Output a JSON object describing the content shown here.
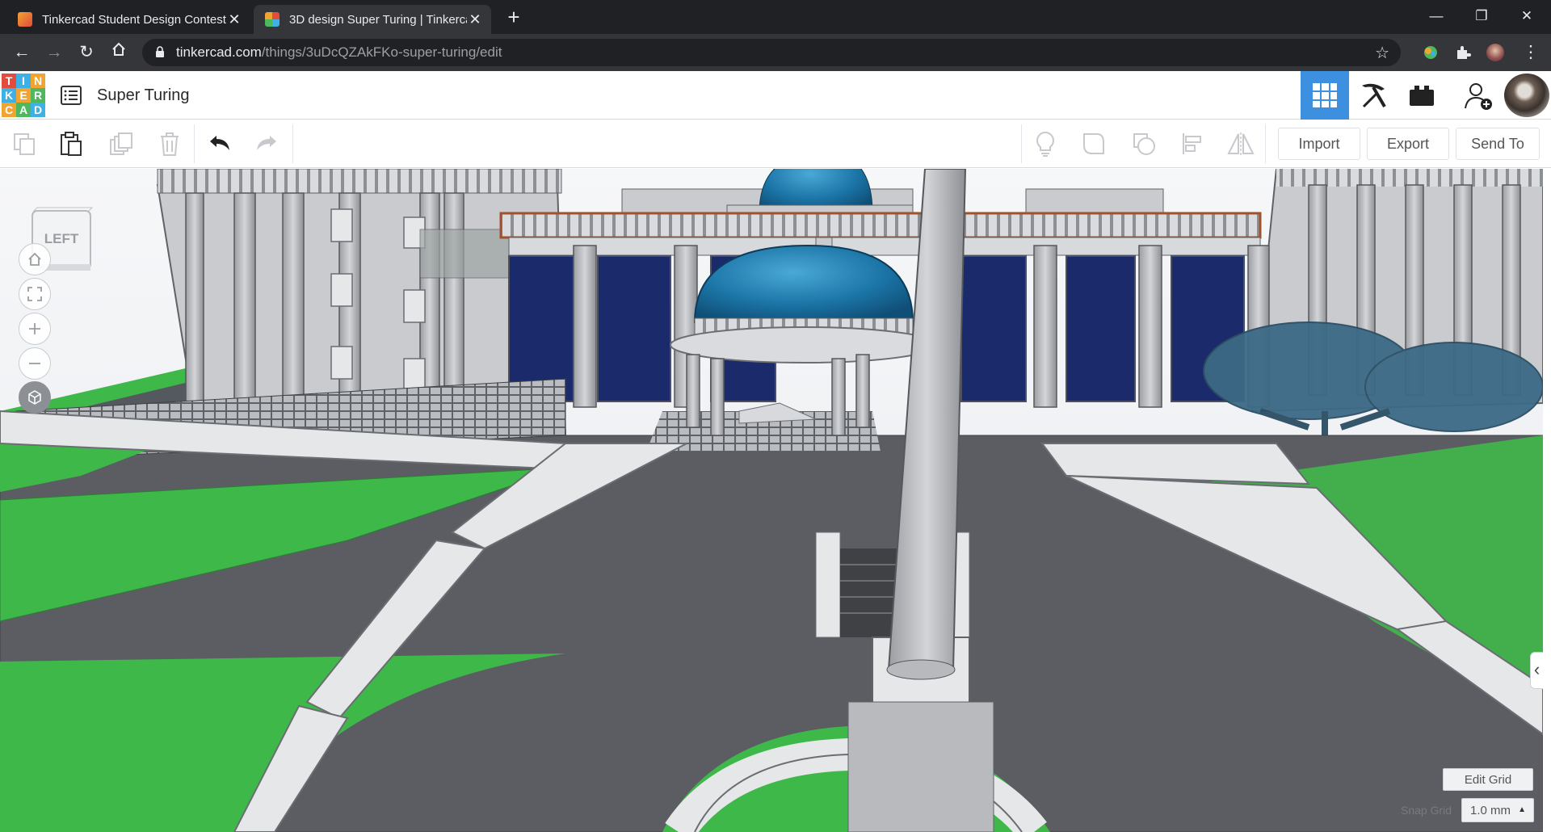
{
  "browser": {
    "tabs": [
      {
        "title": "Tinkercad Student Design Contest",
        "active": false
      },
      {
        "title": "3D design Super Turing | Tinkercad",
        "active": true
      }
    ],
    "url_host": "tinkercad.com",
    "url_path": "/things/3uDcQZAkFKo-super-turing/edit"
  },
  "app": {
    "logo_letters": [
      "T",
      "I",
      "N",
      "K",
      "E",
      "R",
      "C",
      "A",
      "D"
    ],
    "logo_colors": [
      "#e14c3c",
      "#3eb0e6",
      "#f2a431",
      "#3eb0e6",
      "#f2a431",
      "#4db85e",
      "#f2a431",
      "#4db85e",
      "#3eb0e6"
    ],
    "design_title": "Super Turing",
    "accent_color": "#3d8fe0"
  },
  "header_buttons": [
    {
      "name": "3d-design-view",
      "icon": "grid-icon",
      "active": true
    },
    {
      "name": "codeblocks-view",
      "icon": "pickaxe-icon",
      "active": false
    },
    {
      "name": "bricks-view",
      "icon": "briefcase-icon",
      "active": false
    },
    {
      "name": "invite-user",
      "icon": "user-plus-icon",
      "active": false
    }
  ],
  "toolbar": {
    "edit_icons": [
      "copy-icon",
      "paste-icon",
      "duplicate-icon",
      "delete-icon",
      "undo-icon",
      "redo-icon"
    ],
    "shape_icons": [
      "light-bulb-icon",
      "group-icon",
      "ungroup-icon",
      "align-icon",
      "mirror-icon"
    ],
    "import_label": "Import",
    "export_label": "Export",
    "send_to_label": "Send To"
  },
  "viewport": {
    "viewcube_face": "LEFT",
    "nav_controls": [
      "home-view-icon",
      "fit-view-icon",
      "zoom-in-icon",
      "zoom-out-icon",
      "orthographic-icon"
    ],
    "edit_grid_label": "Edit Grid",
    "snap_grid_label": "Snap Grid",
    "snap_grid_value": "1.0 mm"
  },
  "colors": {
    "grass": "#3fb84a",
    "dome": "#1b74a6",
    "window_navy": "#1a2a6b",
    "paving": "#5b5d62",
    "building_grey": "#c9cbce"
  }
}
